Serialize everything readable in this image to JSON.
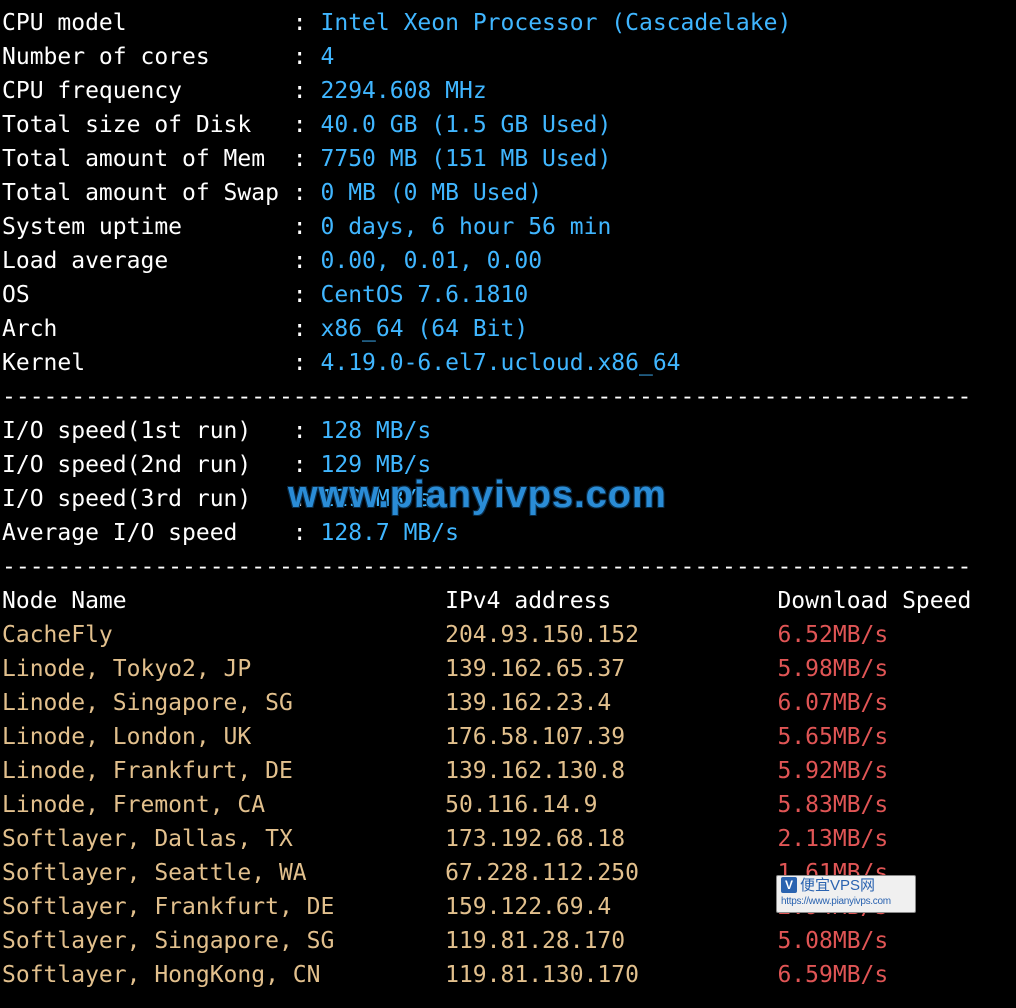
{
  "info": [
    {
      "label": "CPU model            ",
      "value": "Intel Xeon Processor (Cascadelake)"
    },
    {
      "label": "Number of cores      ",
      "value": "4"
    },
    {
      "label": "CPU frequency        ",
      "value": "2294.608 MHz"
    },
    {
      "label": "Total size of Disk   ",
      "value": "40.0 GB (1.5 GB Used)"
    },
    {
      "label": "Total amount of Mem  ",
      "value": "7750 MB (151 MB Used)"
    },
    {
      "label": "Total amount of Swap ",
      "value": "0 MB (0 MB Used)"
    },
    {
      "label": "System uptime        ",
      "value": "0 days, 6 hour 56 min"
    },
    {
      "label": "Load average         ",
      "value": "0.00, 0.01, 0.00"
    },
    {
      "label": "OS                   ",
      "value": "CentOS 7.6.1810"
    },
    {
      "label": "Arch                 ",
      "value": "x86_64 (64 Bit)"
    },
    {
      "label": "Kernel               ",
      "value": "4.19.0-6.el7.ucloud.x86_64"
    }
  ],
  "divider": "----------------------------------------------------------------------",
  "io": [
    {
      "label": "I/O speed(1st run)   ",
      "value": "128 MB/s"
    },
    {
      "label": "I/O speed(2nd run)   ",
      "value": "129 MB/s"
    },
    {
      "label": "I/O speed(3rd run)   ",
      "value": "129 MB/s"
    },
    {
      "label": "Average I/O speed    ",
      "value": "128.7 MB/s"
    }
  ],
  "table_header": {
    "node": "Node Name",
    "ip": "IPv4 address",
    "speed": "Download Speed"
  },
  "nodes": [
    {
      "name": "CacheFly",
      "ip": "204.93.150.152",
      "speed": "6.52MB/s"
    },
    {
      "name": "Linode, Tokyo2, JP",
      "ip": "139.162.65.37",
      "speed": "5.98MB/s"
    },
    {
      "name": "Linode, Singapore, SG",
      "ip": "139.162.23.4",
      "speed": "6.07MB/s"
    },
    {
      "name": "Linode, London, UK",
      "ip": "176.58.107.39",
      "speed": "5.65MB/s"
    },
    {
      "name": "Linode, Frankfurt, DE",
      "ip": "139.162.130.8",
      "speed": "5.92MB/s"
    },
    {
      "name": "Linode, Fremont, CA",
      "ip": "50.116.14.9",
      "speed": "5.83MB/s"
    },
    {
      "name": "Softlayer, Dallas, TX",
      "ip": "173.192.68.18",
      "speed": "2.13MB/s"
    },
    {
      "name": "Softlayer, Seattle, WA",
      "ip": "67.228.112.250",
      "speed": "1.61MB/s"
    },
    {
      "name": "Softlayer, Frankfurt, DE",
      "ip": "159.122.69.4",
      "speed": "2.94MB/s"
    },
    {
      "name": "Softlayer, Singapore, SG",
      "ip": "119.81.28.170",
      "speed": "5.08MB/s"
    },
    {
      "name": "Softlayer, HongKong, CN",
      "ip": "119.81.130.170",
      "speed": "6.59MB/s"
    }
  ],
  "watermark": "www.pianyivps.com",
  "badge": {
    "icon": "V",
    "title": "便宜VPS网",
    "url": "https://www.pianyivps.com"
  }
}
